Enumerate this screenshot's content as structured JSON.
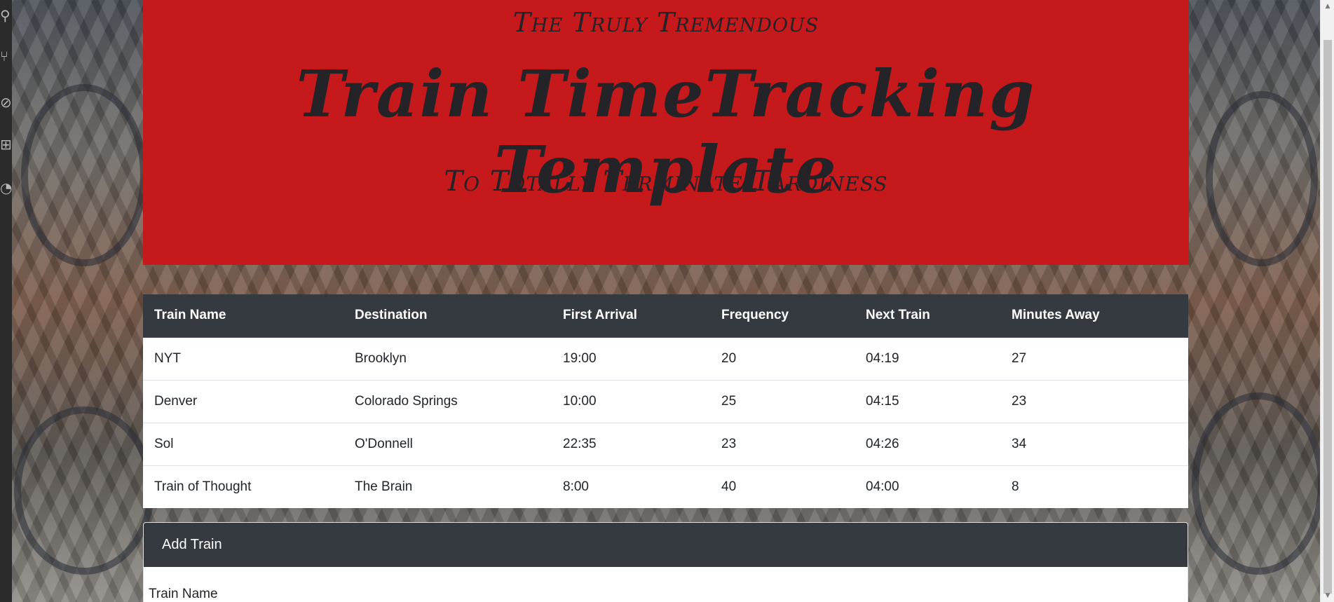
{
  "header": {
    "tagline_top": "The Truly Tremendous",
    "title": "Train TimeTracking Template",
    "tagline_bottom": "To Totally Terminate Tardiness"
  },
  "schedule": {
    "columns": [
      "Train Name",
      "Destination",
      "First Arrival",
      "Frequency",
      "Next Train",
      "Minutes Away"
    ],
    "rows": [
      [
        "NYT",
        "Brooklyn",
        "19:00",
        "20",
        "04:19",
        "27"
      ],
      [
        "Denver",
        "Colorado Springs",
        "10:00",
        "25",
        "04:15",
        "23"
      ],
      [
        "Sol",
        "O'Donnell",
        "22:35",
        "23",
        "04:26",
        "34"
      ],
      [
        "Train of Thought",
        "The Brain",
        "8:00",
        "40",
        "04:00",
        "8"
      ]
    ]
  },
  "add_train": {
    "title": "Add Train",
    "train_name_label": "Train Name"
  },
  "colors": {
    "header_red": "#c5191b",
    "table_head": "#343a40"
  },
  "icons": {
    "left_strip": [
      "search-icon",
      "source-control-icon",
      "debug-icon",
      "extensions-icon",
      "remote-icon"
    ]
  }
}
